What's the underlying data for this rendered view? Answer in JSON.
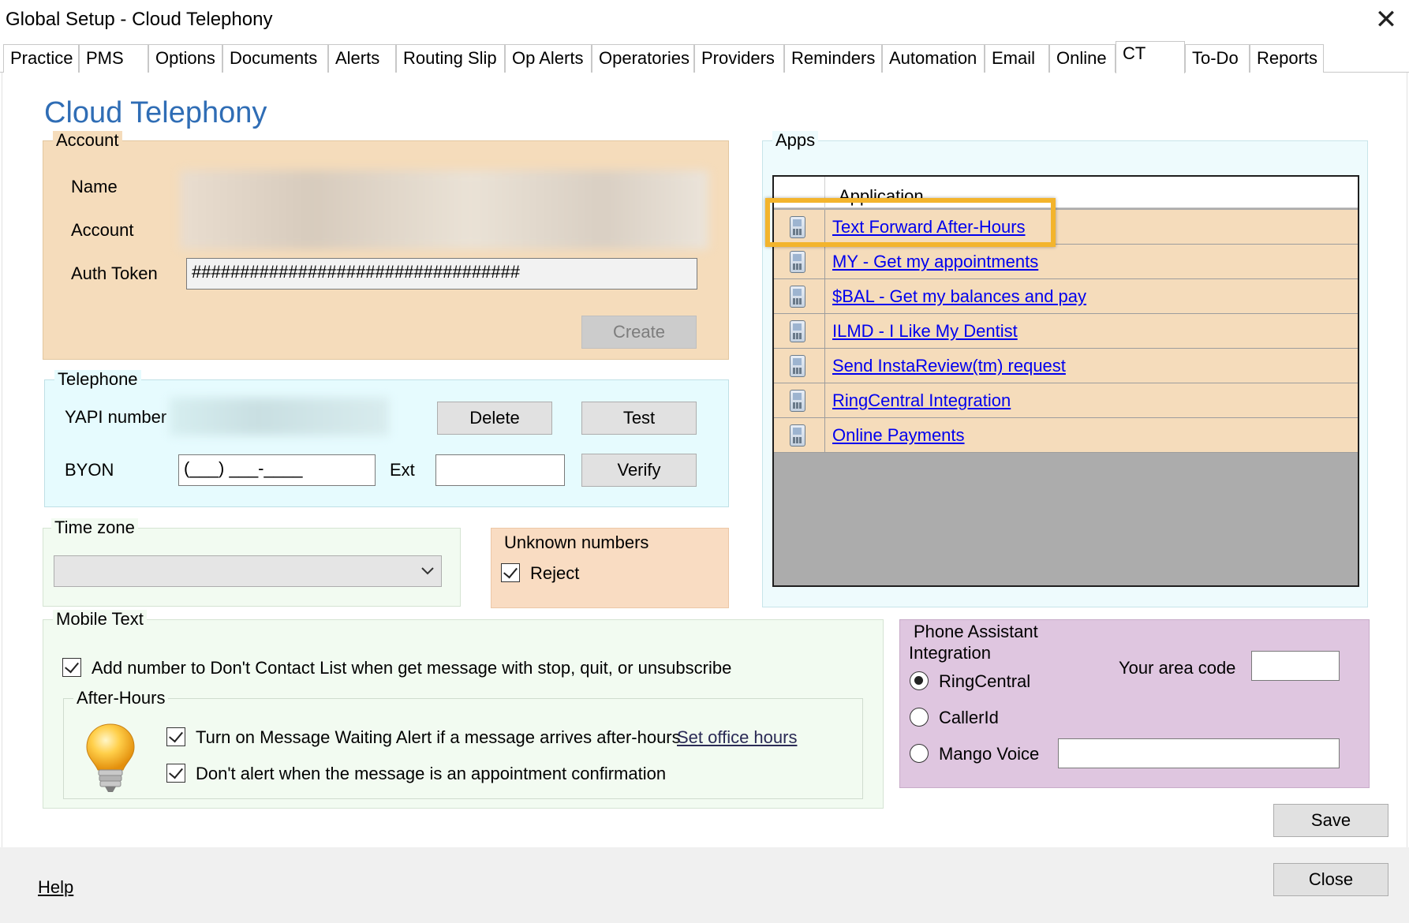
{
  "window": {
    "title": "Global Setup - Cloud Telephony",
    "close_glyph": "✕"
  },
  "tabs": [
    "Practice",
    "PMS",
    "Options",
    "Documents",
    "Alerts",
    "Routing Slip",
    "Op Alerts",
    "Operatories",
    "Providers",
    "Reminders",
    "Automation",
    "Email",
    "Online",
    "CT",
    "To-Do",
    "Reports"
  ],
  "active_tab": "CT",
  "page_title": "Cloud Telephony",
  "account": {
    "legend": "Account",
    "name_label": "Name",
    "account_label": "Account",
    "auth_token_label": "Auth Token",
    "auth_token_value": "##################################",
    "create_button": "Create"
  },
  "telephone": {
    "legend": "Telephone",
    "yapi_label": "YAPI number",
    "delete_button": "Delete",
    "test_button": "Test",
    "byon_label": "BYON",
    "byon_value": "(___) ___-____",
    "ext_label": "Ext",
    "ext_value": "",
    "verify_button": "Verify"
  },
  "timezone": {
    "legend": "Time zone",
    "selected": ""
  },
  "unknown_numbers": {
    "legend": "Unknown numbers",
    "reject_label": "Reject",
    "reject_checked": true
  },
  "apps": {
    "legend": "Apps",
    "column_header": "Application",
    "items": [
      "Text Forward After-Hours",
      "MY - Get my appointments",
      "$BAL - Get my balances and pay",
      "ILMD - I Like My Dentist",
      "Send InstaReview(tm) request",
      "RingCentral Integration",
      "Online Payments"
    ],
    "highlighted_index": 0
  },
  "mobile_text": {
    "legend": "Mobile Text",
    "dont_contact_label": "Add number to Don't Contact List when get message with stop, quit, or unsubscribe",
    "after_hours": {
      "legend": "After-Hours",
      "message_waiting_label": "Turn on Message Waiting Alert if a message arrives after-hours",
      "set_office_hours_link": "Set office hours",
      "dont_alert_label": "Don't alert when the message is an appointment confirmation"
    }
  },
  "phone_assistant": {
    "legend_line1": "Phone Assistant",
    "legend_line2": "Integration",
    "area_code_label": "Your area code",
    "area_code_value": "",
    "options": [
      "RingCentral",
      "CallerId",
      "Mango Voice"
    ],
    "selected": "RingCentral",
    "mango_value": ""
  },
  "footer": {
    "save_button": "Save",
    "close_button": "Close",
    "help_link": "Help"
  },
  "colors": {
    "title_blue": "#2f6db5",
    "account_bg": "#f5dcbb",
    "telephone_bg": "#e6fbfe",
    "unknown_bg": "#f9dcc2",
    "phone_assistant_bg": "#dfc6e0",
    "mobile_bg": "#f2fbf1",
    "highlight": "#f3b42c"
  }
}
